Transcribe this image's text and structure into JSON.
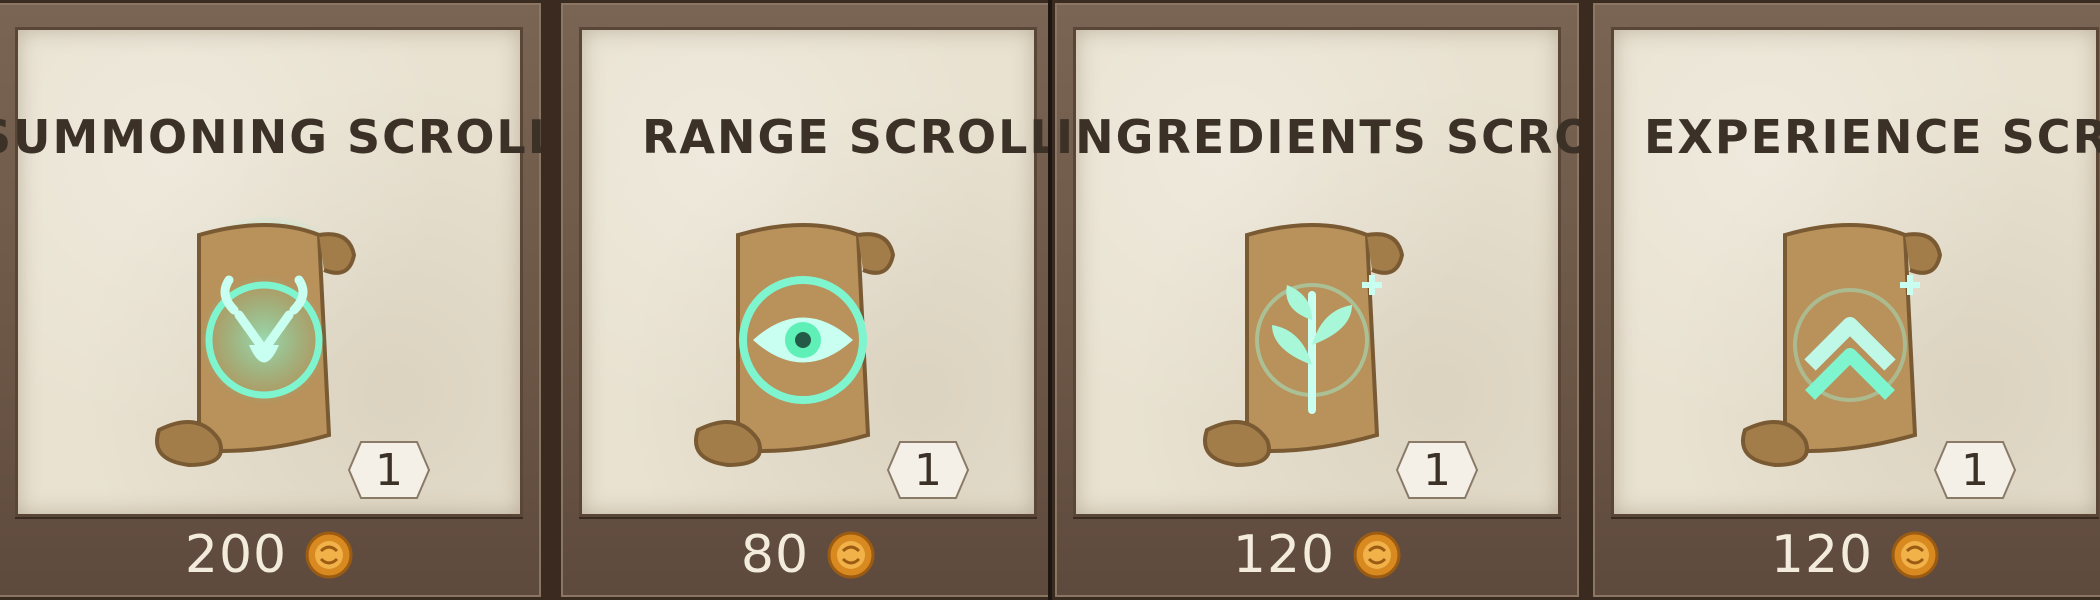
{
  "cards": [
    {
      "title": "Summoning Scroll",
      "quantity": "1",
      "price": "200",
      "icon": "summoning-skull-icon"
    },
    {
      "title": "Range Scroll",
      "quantity": "1",
      "price": "80",
      "icon": "range-eye-icon"
    },
    {
      "title": "Ingredients Scroll",
      "quantity": "1",
      "price": "120",
      "icon": "ingredients-leaf-icon"
    },
    {
      "title": "Experience Scroll",
      "quantity": "1",
      "price": "120",
      "icon": "experience-chevron-icon"
    }
  ],
  "colors": {
    "glow": "#5ff0b8",
    "parchment": "#e9e2d1",
    "frame": "#6b5646",
    "coin": "#e39a2e"
  },
  "currency_icon": "gold-coin-icon"
}
